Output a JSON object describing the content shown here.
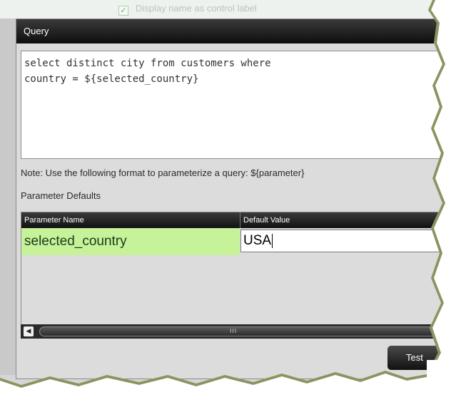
{
  "background": {
    "checkbox_label": "Display name as control label",
    "checkbox_checked": true
  },
  "dialog": {
    "title": "Query",
    "query_text": "select distinct city from customers where\ncountry = ${selected_country}",
    "note": "Note: Use the following format to parameterize a query: ${parameter}",
    "parameter_defaults_label": "Parameter Defaults",
    "table": {
      "columns": [
        "Parameter Name",
        "Default Value"
      ],
      "rows": [
        {
          "name": "selected_country",
          "default_value": "USA"
        }
      ]
    },
    "scroll_grip": "III",
    "test_button_label": "Test"
  },
  "colors": {
    "row_highlight": "#c6f29a",
    "titlebar": "#111111",
    "torn_edge": "#6b7a3a"
  }
}
